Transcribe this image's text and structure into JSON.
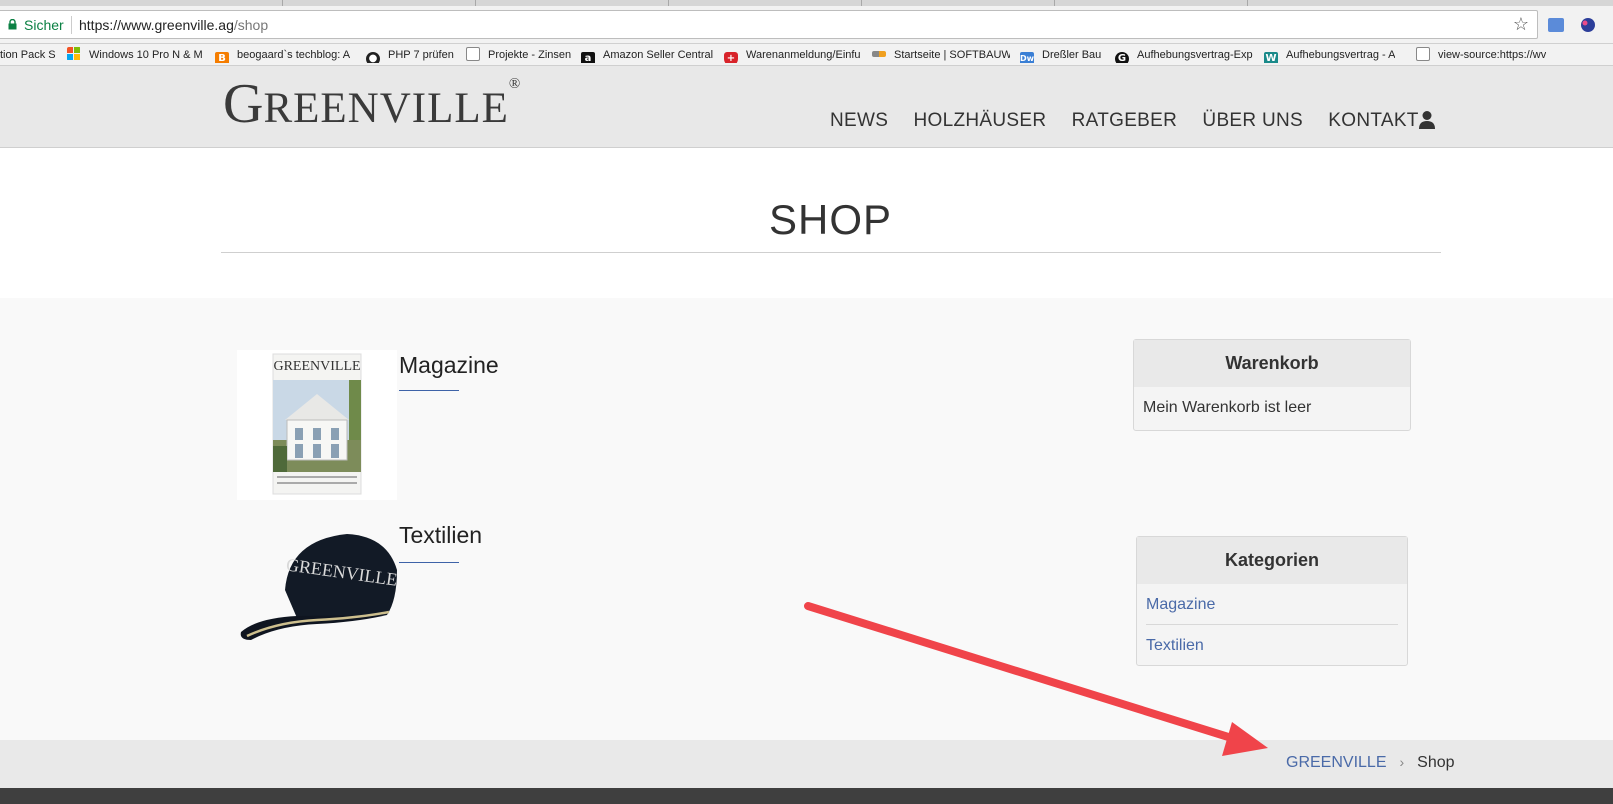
{
  "browser": {
    "secure_label": "Sicher",
    "url_host": "https://www.greenville.ag",
    "url_path": "/shop",
    "bookmarks": [
      {
        "label": "tion Pack S",
        "icon": "page-icon"
      },
      {
        "label": "Windows 10 Pro N & M",
        "icon": "windows-icon"
      },
      {
        "label": "beogaard`s techblog: A",
        "icon": "blogger-icon"
      },
      {
        "label": "PHP 7 prüfen",
        "icon": "github-icon"
      },
      {
        "label": "Projekte - Zinsen",
        "icon": "page-icon"
      },
      {
        "label": "Amazon Seller Central",
        "icon": "amazon-icon"
      },
      {
        "label": "Warenanmeldung/Einfu",
        "icon": "swiss-shield-icon"
      },
      {
        "label": "Startseite | SOFTBAUW",
        "icon": "softbau-icon"
      },
      {
        "label": "Dreßler Bau",
        "icon": "dw-icon"
      },
      {
        "label": "Aufhebungsvertrag-Exp",
        "icon": "g-icon"
      },
      {
        "label": "Aufhebungsvertrag - A",
        "icon": "w-icon"
      },
      {
        "label": "view-source:https://wv",
        "icon": "page-icon"
      }
    ]
  },
  "site": {
    "logo_first": "G",
    "logo_rest": "REENVILLE",
    "logo_mark": "®",
    "nav": [
      "NEWS",
      "HOLZHÄUSER",
      "RATGEBER",
      "ÜBER UNS",
      "KONTAKT"
    ]
  },
  "page": {
    "title": "SHOP"
  },
  "categories": [
    {
      "title": "Magazine",
      "image": "magazine-cover-image",
      "cover_title": "GREENVILLE"
    },
    {
      "title": "Textilien",
      "image": "cap-image",
      "cap_text": "GREENVILLE"
    }
  ],
  "cart": {
    "heading": "Warenkorb",
    "empty_text": "Mein Warenkorb ist leer"
  },
  "sidebar_categories": {
    "heading": "Kategorien",
    "items": [
      "Magazine",
      "Textilien"
    ]
  },
  "breadcrumb": {
    "home": "GREENVILLE",
    "separator": "›",
    "current": "Shop"
  },
  "colors": {
    "link": "#4a6aa8",
    "secure": "#0b8043",
    "arrow": "#f0444a"
  }
}
